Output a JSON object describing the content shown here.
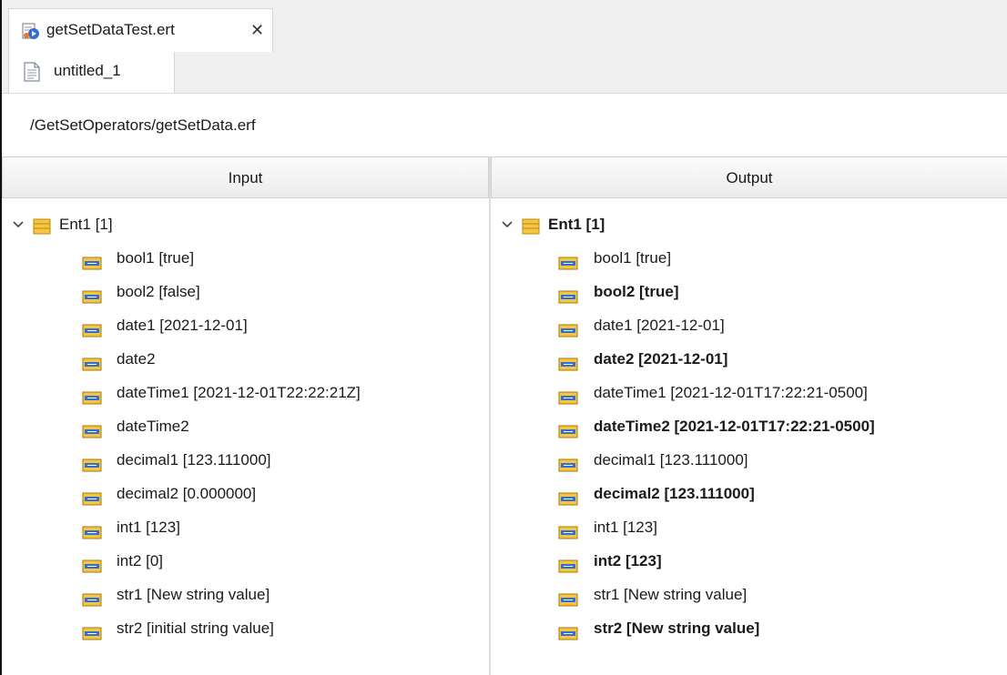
{
  "editor_tab": {
    "title": "getSetDataTest.ert",
    "close": "✕"
  },
  "sub_tab": {
    "label": "untitled_1"
  },
  "path": "/GetSetOperators/getSetData.erf",
  "input": {
    "header": "Input",
    "root": "Ent1 [1]",
    "items": [
      {
        "label": "bool1 [true]",
        "bold": false
      },
      {
        "label": "bool2 [false]",
        "bold": false
      },
      {
        "label": "date1 [2021-12-01]",
        "bold": false
      },
      {
        "label": "date2",
        "bold": false
      },
      {
        "label": "dateTime1 [2021-12-01T22:22:21Z]",
        "bold": false
      },
      {
        "label": "dateTime2",
        "bold": false
      },
      {
        "label": "decimal1 [123.111000]",
        "bold": false
      },
      {
        "label": "decimal2 [0.000000]",
        "bold": false
      },
      {
        "label": "int1 [123]",
        "bold": false
      },
      {
        "label": "int2 [0]",
        "bold": false
      },
      {
        "label": "str1 [New string value]",
        "bold": false
      },
      {
        "label": "str2 [initial string value]",
        "bold": false
      }
    ]
  },
  "output": {
    "header": "Output",
    "root": "Ent1 [1]",
    "items": [
      {
        "label": "bool1 [true]",
        "bold": false
      },
      {
        "label": "bool2 [true]",
        "bold": true
      },
      {
        "label": "date1 [2021-12-01]",
        "bold": false
      },
      {
        "label": "date2 [2021-12-01]",
        "bold": true
      },
      {
        "label": "dateTime1 [2021-12-01T17:22:21-0500]",
        "bold": false
      },
      {
        "label": "dateTime2 [2021-12-01T17:22:21-0500]",
        "bold": true
      },
      {
        "label": "decimal1 [123.111000]",
        "bold": false
      },
      {
        "label": "decimal2 [123.111000]",
        "bold": true
      },
      {
        "label": "int1 [123]",
        "bold": false
      },
      {
        "label": "int2 [123]",
        "bold": true
      },
      {
        "label": "str1 [New string value]",
        "bold": false
      },
      {
        "label": "str2 [New string value]",
        "bold": true
      }
    ]
  },
  "colors": {
    "icon_yellow": "#f6c542",
    "icon_blue": "#2f6fd6",
    "tab_bg": "#f0f0f0"
  }
}
